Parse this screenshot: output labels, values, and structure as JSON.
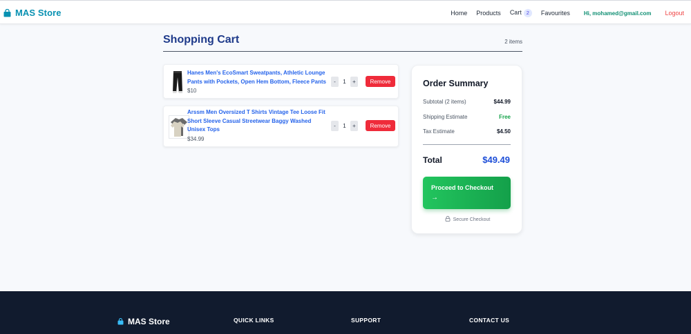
{
  "header": {
    "brand": "MAS Store",
    "nav": {
      "home": "Home",
      "products": "Products",
      "cart": "Cart",
      "cart_count": "2",
      "favourites": "Favourites",
      "user": "Hi, mohamed@gmail.com",
      "logout": "Logout"
    }
  },
  "cart": {
    "title": "Shopping Cart",
    "count_label": "2 items",
    "items": [
      {
        "name": "Hanes Men's EcoSmart Sweatpants, Athletic Lounge Pants with Pockets, Open Hem Bottom, Fleece Pants",
        "price": "$10",
        "quantity": "1",
        "minus": "-",
        "plus": "+",
        "remove": "Remove"
      },
      {
        "name": "Arssm Men Oversized T Shirts Vintage Tee Loose Fit Short Sleeve Casual Streetwear Baggy Washed Unisex Tops",
        "price": "$34.99",
        "quantity": "1",
        "minus": "-",
        "plus": "+",
        "remove": "Remove"
      }
    ]
  },
  "summary": {
    "title": "Order Summary",
    "subtotal_label": "Subtotal (2 items)",
    "subtotal_value": "$44.99",
    "shipping_label": "Shipping Estimate",
    "shipping_value": "Free",
    "tax_label": "Tax Estimate",
    "tax_value": "$4.50",
    "total_label": "Total",
    "total_value": "$49.49",
    "checkout_label": "Proceed to Checkout",
    "checkout_arrow": "→",
    "secure_label": "Secure Checkout"
  },
  "footer": {
    "brand": "MAS Store",
    "headings": [
      "QUICK LINKS",
      "SUPPORT",
      "CONTACT US"
    ]
  },
  "colors": {
    "brand": "#0891b2",
    "title": "#1e3a8a",
    "link": "#2563eb",
    "remove": "#ef2b3a",
    "checkout": "#22c55e",
    "total": "#1d4ed8",
    "footer_bg": "#111b2e"
  },
  "icons": {
    "brand": "shopping-bag-icon",
    "secure": "lock-icon"
  }
}
